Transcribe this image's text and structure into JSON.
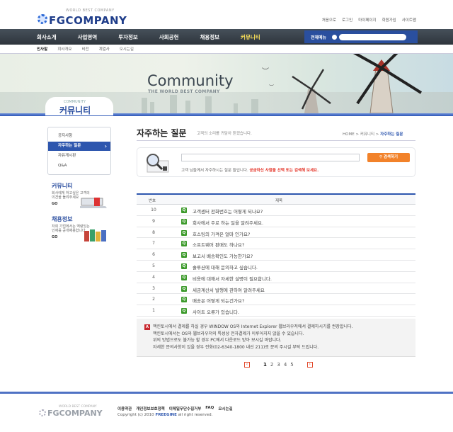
{
  "header": {
    "logo_sub": "WORLD BEST COMPANY",
    "logo_main": "FGCOMPANY",
    "top_links": [
      "처음으로",
      "로그인",
      "마이페이지",
      "회원가입",
      "사이트맵"
    ]
  },
  "gnb": {
    "items": [
      "회사소개",
      "사업영역",
      "투자정보",
      "사회공헌",
      "채용정보",
      "커뮤니티"
    ],
    "all_menu_label": "전체메뉴"
  },
  "lnb": {
    "items": [
      "인사말",
      "회사개요",
      "비전",
      "계열사",
      "오시는길"
    ]
  },
  "visual": {
    "title": "Community",
    "subtitle": "THE WORLD BEST COMPANY"
  },
  "section_title": {
    "en": "COMMUNITY",
    "ko": "커뮤니티"
  },
  "sidebar": {
    "items": [
      "공지사항",
      "자주하는 질문",
      "자유게시판",
      "Q&A"
    ],
    "promos": [
      {
        "title": "커뮤니티",
        "desc": "회사에게 하고싶은 고객의 의견을 들려주세요",
        "go": "GO"
      },
      {
        "title": "채용정보",
        "desc": "저희 기업에서는 역량있는 인재를 공개채용합니다.",
        "go": "GO"
      }
    ]
  },
  "page": {
    "title": "자주하는 질문",
    "desc": "고객의 소리를 귀담아 듣겠습니다.",
    "breadcrumb": {
      "home": "HOME",
      "sep": ">",
      "parent": "커뮤니티",
      "current": "자주하는 질문"
    }
  },
  "search": {
    "button_label": "검색하기",
    "desc_plain": "고객 님들께서 자주하시는 질문 들입니다. ",
    "desc_highlight": "궁금하신 사항을 선택 또는 검색해 보세요."
  },
  "table": {
    "headers": [
      "번호",
      "제목"
    ],
    "rows": [
      {
        "num": "10",
        "title": "고객센터 전화번호는 어떻게 되나요?"
      },
      {
        "num": "9",
        "title": "회사에서 주로 하는 일을 알려주세요."
      },
      {
        "num": "8",
        "title": "호스팅의 가격은 얼마 인가요?"
      },
      {
        "num": "7",
        "title": "소프트웨어 판매도 하나요?"
      },
      {
        "num": "6",
        "title": "보고서 배송확인도 가능한가요?"
      },
      {
        "num": "5",
        "title": "솔루션에 대해 문의하고 싶습니다."
      },
      {
        "num": "4",
        "title": "비용에 대해서 자세한 설명이 필요합니다."
      },
      {
        "num": "3",
        "title": "세금계산서 발행에 관하여 알려주세요"
      },
      {
        "num": "2",
        "title": "배송은 어떻게 되는건가요?"
      },
      {
        "num": "1",
        "title": "사이트 오류가 있습니다."
      }
    ],
    "q_mark": "Q"
  },
  "answer": {
    "mark": "A",
    "lines": [
      "맥킨토시에서 결제를 하실 경우 WINDOW OS와 Internet Explorer 웹브라우저에서 결제하시기를 권장합니다.",
      "맥킨토시에서는 OS와 웹브라우저의 특성상 전자결제가 이루어지지 않을 수 있습니다.",
      "위의 방법으로도 불가능 할 경우 PC에서 다운로드 받아 보시길 바랍니다.",
      "자세한 문의사항이 있을 경우 전화(02-6340-1800 내선 211)로 문의 주시길 부탁 드립니다."
    ]
  },
  "pager": {
    "prev": "‹",
    "next": "›",
    "pages": [
      "1",
      "2",
      "3",
      "4",
      "5"
    ],
    "current": "1"
  },
  "footer": {
    "logo_sub": "WORLD BEST COMPANY",
    "logo_main": "FGCOMPANY",
    "links": [
      "이용약관",
      "개인정보보호정책",
      "이메일무단수집거부",
      "FAQ",
      "오시는길"
    ],
    "copy_pre": "Copyright (c) 2010 ",
    "copy_brand": "FREEGINE",
    "copy_post": " all right reserved."
  },
  "colors": {
    "brand": "#2d56ae",
    "accent": "#f2822a",
    "nav_dark": "#3a424a",
    "q_green": "#3c9a2b",
    "a_red": "#c8262c"
  }
}
